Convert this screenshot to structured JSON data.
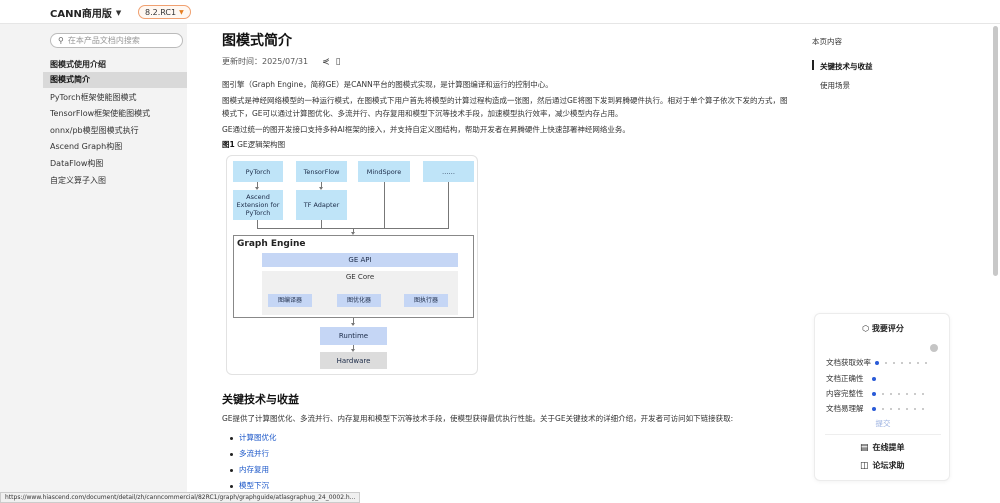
{
  "header": {
    "brand": "CANN商用版",
    "version": "8.2.RC1"
  },
  "sidebar": {
    "search_placeholder": "在本产品文档内搜索",
    "group_title": "图模式使用介绍",
    "items": [
      {
        "label": "图模式简介",
        "active": true
      },
      {
        "label": "PyTorch框架使能图模式"
      },
      {
        "label": "TensorFlow框架使能图模式"
      },
      {
        "label": "onnx/pb模型图模式执行"
      },
      {
        "label": "Ascend Graph构图"
      },
      {
        "label": "DataFlow构图"
      },
      {
        "label": "自定义算子入图"
      }
    ]
  },
  "article": {
    "title": "图模式简介",
    "updated_label": "更新时间：",
    "updated_date": "2025/07/31",
    "paragraphs": [
      "图引擎（Graph Engine，简称GE）是CANN平台的图模式实现，是计算图编译和运行的控制中心。",
      "图模式是神经网络模型的一种运行模式，在图模式下用户首先将模型的计算过程构造成一张图，然后通过GE将图下发到昇腾硬件执行。相对于单个算子依次下发的方式，图模式下，GE可以通过计算图优化、多流并行、内存复用和模型下沉等技术手段，加速模型执行效率，减少模型内存占用。",
      "GE通过统一的图开发接口支持多种AI框架的接入，并支持自定义图结构，帮助开发者在昇腾硬件上快速部署神经网络业务。"
    ],
    "figure_label": "图1",
    "figure_caption": " GE逻辑架构图",
    "diagram": {
      "frameworks": [
        "PyTorch",
        "TensorFlow",
        "MindSpore",
        "……"
      ],
      "adapters": [
        "Ascend Extension for PyTorch",
        "TF Adapter"
      ],
      "ge_title": "Graph Engine",
      "ge_api": "GE API",
      "ge_core": "GE Core",
      "core_modules": [
        "图编译器",
        "图优化器",
        "图执行器"
      ],
      "runtime": "Runtime",
      "hardware": "Hardware"
    },
    "section_title": "关键技术与收益",
    "section_text": "GE提供了计算图优化、多流并行、内存复用和模型下沉等技术手段，使模型获得最优执行性能。关于GE关键技术的详细介绍，开发者可访问如下链接获取:",
    "links": [
      "计算图优化",
      "多流并行",
      "内存复用",
      "模型下沉"
    ]
  },
  "toc": {
    "title": "本页内容",
    "items": [
      {
        "label": "关键技术与收益",
        "active": true
      },
      {
        "label": "使用场景"
      }
    ]
  },
  "rating": {
    "title": "我要评分",
    "criteria": [
      "文档获取效率",
      "文档正确性",
      "内容完整性",
      "文档易理解"
    ],
    "submit": "提交",
    "online_ticket": "在线提单",
    "forum_help": "论坛求助"
  },
  "status_url": "https://www.hiascend.com/document/detail/zh/canncommercial/82RC1/graph/graphguide/atlasgraphug_24_0002.h...",
  "colors": {
    "accent": "#2a5bd7",
    "link": "#1a56c8",
    "framework_box": "#bfe4f8",
    "engine_box": "#c5d6f5",
    "version_border": "#f0a070"
  },
  "icons": [
    "chevron-down-icon",
    "search-icon",
    "share-icon",
    "pdf-icon",
    "rate-icon",
    "ticket-icon",
    "forum-icon"
  ]
}
